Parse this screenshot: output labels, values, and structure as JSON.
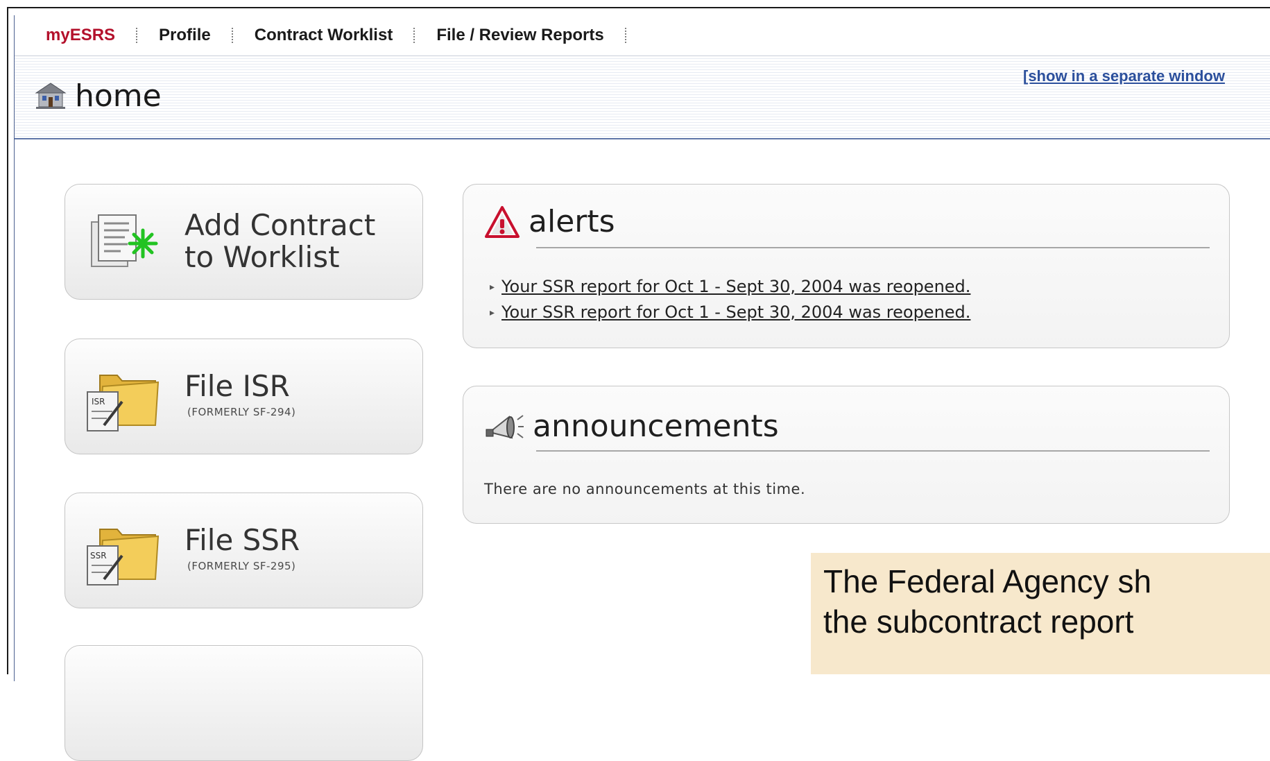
{
  "nav": {
    "brand": "myESRS",
    "items": [
      "Profile",
      "Contract Worklist",
      "File / Review Reports"
    ]
  },
  "header": {
    "title": "home",
    "separate_window_link": "[show in a separate window"
  },
  "tiles": [
    {
      "label_line1": "Add Contract",
      "label_line2": "to Worklist",
      "icon": "add-document-icon"
    },
    {
      "label_line1": "File ISR",
      "sublabel": "(FORMERLY SF-294)",
      "icon_text": "ISR",
      "icon": "folder-form-icon"
    },
    {
      "label_line1": "File SSR",
      "sublabel": "(FORMERLY SF-295)",
      "icon_text": "SSR",
      "icon": "folder-form-icon"
    }
  ],
  "alerts": {
    "title": "alerts",
    "items": [
      "Your SSR report for Oct 1 - Sept 30, 2004 was reopened.",
      "Your SSR report for Oct 1 - Sept 30, 2004 was reopened."
    ]
  },
  "announcements": {
    "title": "announcements",
    "message": "There are no announcements at this time."
  },
  "caption": {
    "line1": "The Federal Agency sh",
    "line2": "the subcontract report"
  },
  "colors": {
    "brand": "#b3102b",
    "link": "#2b4f9c",
    "caption_bg": "#f7e8cc",
    "alert_red": "#c8102e",
    "accent_green": "#22c322"
  }
}
